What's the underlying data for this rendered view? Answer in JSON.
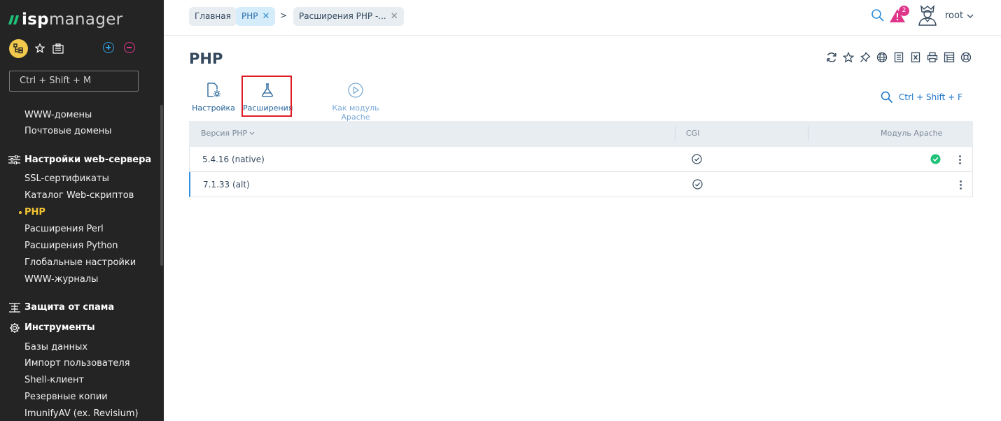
{
  "brand": {
    "name_bold": "isp",
    "name_rest": "manager"
  },
  "sidebar": {
    "search_placeholder": "Ctrl + Shift + M",
    "items": [
      {
        "label": "WWW-домены",
        "type": "item"
      },
      {
        "label": "Почтовые домены",
        "type": "item"
      },
      {
        "label": "Настройки web-сервера",
        "type": "group",
        "icon": "sliders-icon"
      },
      {
        "label": "SSL-сертификаты",
        "type": "item"
      },
      {
        "label": "Каталог Web-скриптов",
        "type": "item"
      },
      {
        "label": "PHP",
        "type": "item",
        "active": true
      },
      {
        "label": "Расширения Perl",
        "type": "item"
      },
      {
        "label": "Расширения Python",
        "type": "item"
      },
      {
        "label": "Глобальные настройки",
        "type": "item"
      },
      {
        "label": "WWW-журналы",
        "type": "item"
      },
      {
        "label": "Защита от спама",
        "type": "group",
        "icon": "filter-icon"
      },
      {
        "label": "Инструменты",
        "type": "group",
        "icon": "gear-icon"
      },
      {
        "label": "Базы данных",
        "type": "item"
      },
      {
        "label": "Импорт пользователя",
        "type": "item"
      },
      {
        "label": "Shell-клиент",
        "type": "item"
      },
      {
        "label": "Резервные копии",
        "type": "item"
      },
      {
        "label": "ImunifyAV (ex. Revisium)",
        "type": "item"
      }
    ]
  },
  "breadcrumbs": [
    {
      "label": "Главная",
      "closable": false,
      "active": false
    },
    {
      "label": "PHP",
      "closable": true,
      "active": true
    },
    {
      "label": "Расширения PHP -...",
      "closable": true,
      "active": false
    }
  ],
  "breadcrumb_separator": ">",
  "topbar": {
    "alerts_count": "2",
    "user": "root"
  },
  "page": {
    "title": "PHP",
    "toolbar": [
      {
        "label": "Настройка",
        "icon": "settings-doc-icon",
        "enabled": true
      },
      {
        "label": "Расширения",
        "icon": "flask-icon",
        "enabled": true,
        "highlighted": true
      },
      {
        "label": "Как модуль Apache",
        "icon": "play-circle-icon",
        "enabled": false
      }
    ],
    "filter_hint": "Ctrl + Shift + F"
  },
  "table": {
    "columns": [
      "Версия PHP",
      "CGI",
      "Модуль Apache"
    ],
    "rows": [
      {
        "version": "5.4.16 (native)",
        "cgi": true,
        "apache": true,
        "selected": false
      },
      {
        "version": "7.1.33 (alt)",
        "cgi": true,
        "apache": false,
        "selected": true
      }
    ]
  },
  "colors": {
    "sidebar_bg": "#242424",
    "accent_yellow": "#f4c430",
    "accent_blue": "#2f8fdc",
    "success_green": "#1ec279",
    "alert_pink": "#e0368a",
    "highlight_red": "#e01b24"
  }
}
